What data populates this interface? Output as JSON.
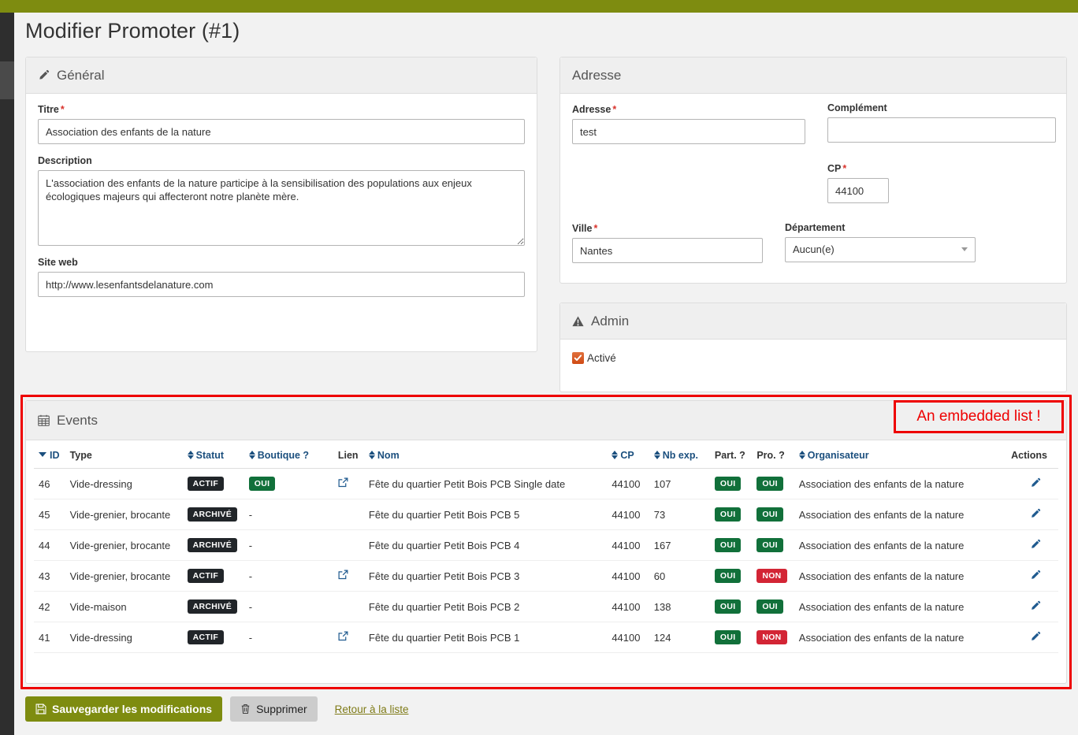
{
  "page": {
    "title": "Modifier Promoter (#1)"
  },
  "theme": {
    "topbar": "#7e8c10",
    "rail": "#2e2e2e",
    "rail_active": "#4a4a4a",
    "accent": "#7e8c10",
    "link": "#1b4f7e",
    "annotation": "#ee0000"
  },
  "general": {
    "heading": "Général",
    "heading_icon": "pencil-icon",
    "titre": {
      "label": "Titre",
      "required": "*",
      "value": "Association des enfants de la nature"
    },
    "description": {
      "label": "Description",
      "value": "L'association des enfants de la nature participe à la sensibilisation des populations aux enjeux écologiques majeurs qui affecteront notre planète mère."
    },
    "site_web": {
      "label": "Site web",
      "value": "http://www.lesenfantsdelanature.com"
    }
  },
  "adresse": {
    "heading": "Adresse",
    "adresse": {
      "label": "Adresse",
      "required": "*",
      "value": "test"
    },
    "complement": {
      "label": "Complément",
      "value": ""
    },
    "cp": {
      "label": "CP",
      "required": "*",
      "value": "44100"
    },
    "ville": {
      "label": "Ville",
      "required": "*",
      "value": "Nantes"
    },
    "departement": {
      "label": "Département",
      "value": "Aucun(e)",
      "icon": "chevron-down-icon"
    }
  },
  "admin": {
    "heading": "Admin",
    "heading_icon": "warning-triangle-icon",
    "active": {
      "label": "Activé",
      "checked": true
    }
  },
  "events": {
    "heading": "Events",
    "heading_icon": "calendar-icon",
    "annotation": "An embedded list !",
    "columns": [
      {
        "key": "id",
        "label": "ID",
        "sort": "desc"
      },
      {
        "key": "type",
        "label": "Type",
        "sort": "none"
      },
      {
        "key": "statut",
        "label": "Statut",
        "sort": "both"
      },
      {
        "key": "boutique",
        "label": "Boutique ?",
        "sort": "both"
      },
      {
        "key": "lien",
        "label": "Lien",
        "sort": "none"
      },
      {
        "key": "nom",
        "label": "Nom",
        "sort": "both"
      },
      {
        "key": "cp",
        "label": "CP",
        "sort": "both"
      },
      {
        "key": "nb_exp",
        "label": "Nb exp.",
        "sort": "both"
      },
      {
        "key": "part",
        "label": "Part. ?",
        "sort": "none"
      },
      {
        "key": "pro",
        "label": "Pro. ?",
        "sort": "none"
      },
      {
        "key": "organisateur",
        "label": "Organisateur",
        "sort": "both"
      },
      {
        "key": "actions",
        "label": "Actions",
        "sort": "none"
      }
    ],
    "rows": [
      {
        "id": "46",
        "type": "Vide-dressing",
        "statut": "ACTIF",
        "statut_style": "dark",
        "boutique": "OUI",
        "boutique_style": "green",
        "lien": "external-link-icon",
        "nom": "Fête du quartier Petit Bois PCB Single date",
        "cp": "44100",
        "nb_exp": "107",
        "part": "OUI",
        "part_style": "green",
        "pro": "OUI",
        "pro_style": "green",
        "organisateur": "Association des enfants de la nature",
        "action": "edit-icon"
      },
      {
        "id": "45",
        "type": "Vide-grenier, brocante",
        "statut": "ARCHIVÉ",
        "statut_style": "dark",
        "boutique": "-",
        "boutique_style": "dash",
        "lien": "",
        "nom": "Fête du quartier Petit Bois PCB 5",
        "cp": "44100",
        "nb_exp": "73",
        "part": "OUI",
        "part_style": "green",
        "pro": "OUI",
        "pro_style": "green",
        "organisateur": "Association des enfants de la nature",
        "action": "edit-icon"
      },
      {
        "id": "44",
        "type": "Vide-grenier, brocante",
        "statut": "ARCHIVÉ",
        "statut_style": "dark",
        "boutique": "-",
        "boutique_style": "dash",
        "lien": "",
        "nom": "Fête du quartier Petit Bois PCB 4",
        "cp": "44100",
        "nb_exp": "167",
        "part": "OUI",
        "part_style": "green",
        "pro": "OUI",
        "pro_style": "green",
        "organisateur": "Association des enfants de la nature",
        "action": "edit-icon"
      },
      {
        "id": "43",
        "type": "Vide-grenier, brocante",
        "statut": "ACTIF",
        "statut_style": "dark",
        "boutique": "-",
        "boutique_style": "dash",
        "lien": "external-link-icon",
        "nom": "Fête du quartier Petit Bois PCB 3",
        "cp": "44100",
        "nb_exp": "60",
        "part": "OUI",
        "part_style": "green",
        "pro": "NON",
        "pro_style": "red",
        "organisateur": "Association des enfants de la nature",
        "action": "edit-icon"
      },
      {
        "id": "42",
        "type": "Vide-maison",
        "statut": "ARCHIVÉ",
        "statut_style": "dark",
        "boutique": "-",
        "boutique_style": "dash",
        "lien": "",
        "nom": "Fête du quartier Petit Bois PCB 2",
        "cp": "44100",
        "nb_exp": "138",
        "part": "OUI",
        "part_style": "green",
        "pro": "OUI",
        "pro_style": "green",
        "organisateur": "Association des enfants de la nature",
        "action": "edit-icon"
      },
      {
        "id": "41",
        "type": "Vide-dressing",
        "statut": "ACTIF",
        "statut_style": "dark",
        "boutique": "-",
        "boutique_style": "dash",
        "lien": "external-link-icon",
        "nom": "Fête du quartier Petit Bois PCB 1",
        "cp": "44100",
        "nb_exp": "124",
        "part": "OUI",
        "part_style": "green",
        "pro": "NON",
        "pro_style": "red",
        "organisateur": "Association des enfants de la nature",
        "action": "edit-icon"
      }
    ]
  },
  "footer": {
    "save_label": "Sauvegarder les modifications",
    "save_icon": "save-icon",
    "delete_label": "Supprimer",
    "delete_icon": "trash-icon",
    "back_label": "Retour à la liste"
  }
}
